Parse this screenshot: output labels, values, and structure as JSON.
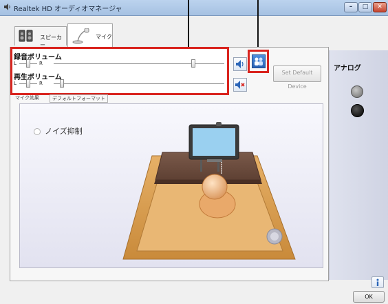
{
  "window": {
    "title": "Realtek HD オーディオマネージャ"
  },
  "tabs": [
    {
      "label": "スピーカー"
    },
    {
      "label": "マイク"
    }
  ],
  "volume": {
    "recording_label": "録音ボリューム",
    "playback_label": "再生ボリューム",
    "left": "L",
    "right": "R",
    "recording_level": 0.82,
    "playback_level": 0.05
  },
  "buttons": {
    "set_default_device": "Set Default Device",
    "ok": "OK"
  },
  "sub_tabs": {
    "first": "マイク効果",
    "second": "デフォルトフォーマット"
  },
  "noise_suppression": {
    "label": "ノイズ抑制"
  },
  "side_panel": {
    "label": "アナログ"
  },
  "colors": {
    "highlight": "#d9241e",
    "side_panel": "#dfe2ee",
    "title_bar": "#bcd3ee"
  }
}
